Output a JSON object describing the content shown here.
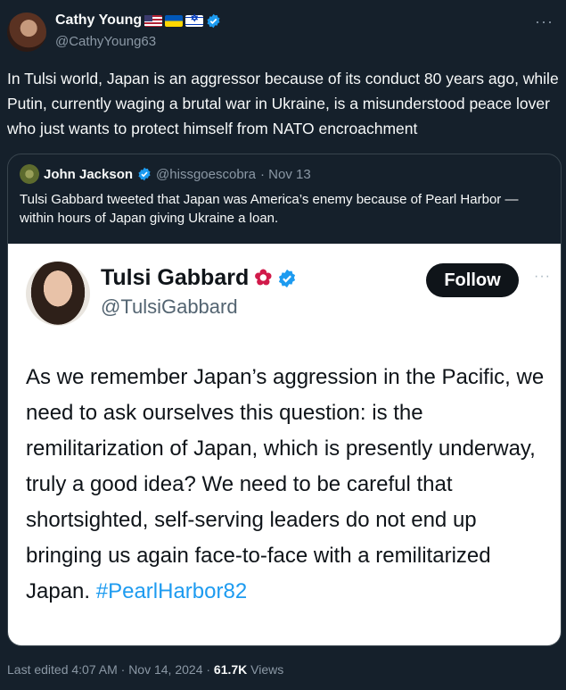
{
  "tweet": {
    "author_name": "Cathy Young",
    "author_flags": [
      "us-flag",
      "ukraine-flag",
      "israel-flag"
    ],
    "author_handle": "@CathyYoung63",
    "more_label": "···",
    "text": "In Tulsi world, Japan is an aggressor because of its conduct 80 years ago, while Putin, currently waging a brutal war in Ukraine, is a misunderstood peace lover who just wants to protect himself from NATO encroachment",
    "footer": {
      "edited": "Last edited 4:07 AM · Nov 14, 2024 · ",
      "views_count": "61.7K",
      "views_label": " Views"
    }
  },
  "quote": {
    "author_name": "John Jackson",
    "author_handle": "@hissgoescobra",
    "date": "· Nov 13",
    "text": "Tulsi Gabbard tweeted that Japan was America’s enemy because of Pearl Harbor —within hours of Japan giving Ukraine a loan.",
    "screenshot": {
      "name": "Tulsi Gabbard",
      "handle": "@TulsiGabbard",
      "follow_label": "Follow",
      "more_label": "···",
      "text": "As we remember Japan’s aggression in the Pacific, we need to ask ourselves this question: is the remilitarization of Japan, which is presently underway, truly a good idea? We need to be careful that shortsighted, self-serving leaders do not end up bringing us again face-to-face with a remilitarized Japan. ",
      "hashtag": "#PearlHarbor82"
    }
  },
  "colors": {
    "background": "#15202b",
    "verified": "#1d9bf0",
    "muted": "#8b98a5",
    "hashtag": "#1d9bf0"
  }
}
